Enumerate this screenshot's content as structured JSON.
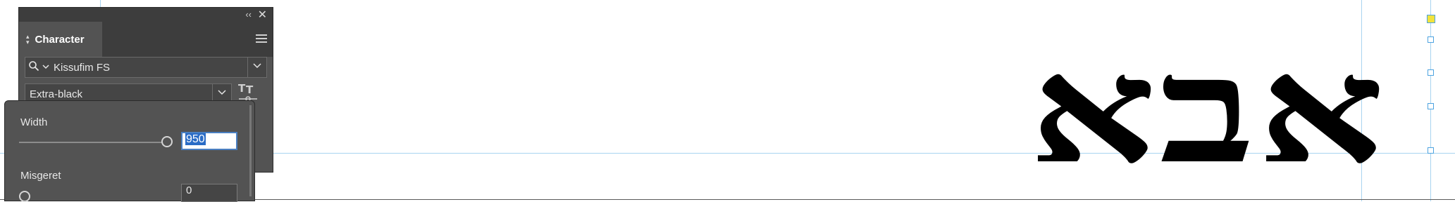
{
  "canvas": {
    "sample_text": "אבא",
    "guide_color": "#a8d4f0",
    "selection_color": "#4da3e0"
  },
  "panel": {
    "tab_label": "Character",
    "collapse_glyph": "‹‹",
    "close_glyph": "✕",
    "font_family": "Kissufim FS",
    "font_style": "Extra-black",
    "icons": [
      "search-icon",
      "chevron-down-icon",
      "panel-menu-icon",
      "type-styles-icon",
      "collapse-icon",
      "close-icon"
    ]
  },
  "flyout": {
    "width_label": "Width",
    "width_value": "950",
    "misgeret_label": "Misgeret",
    "misgeret_value": "0"
  }
}
